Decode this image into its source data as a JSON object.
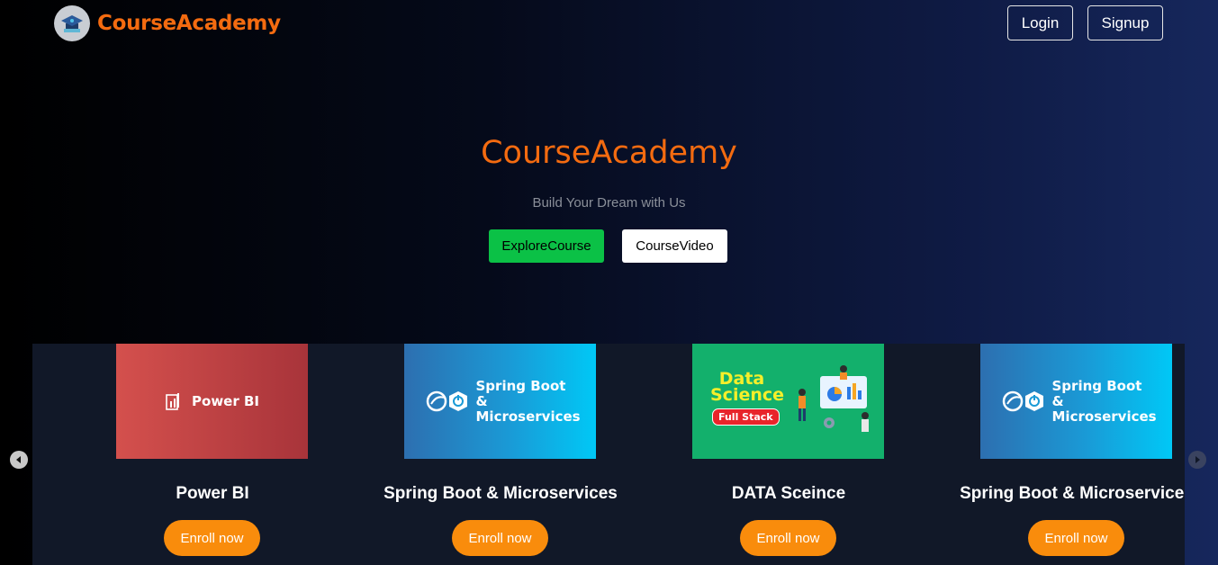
{
  "header": {
    "brand": "CourseAcademy",
    "login_label": "Login",
    "signup_label": "Signup"
  },
  "hero": {
    "title": "CourseAcademy",
    "subtitle": "Build Your Dream with Us",
    "explore_label": "ExploreCourse",
    "video_label": "CourseVideo"
  },
  "courses": [
    {
      "title": "Power BI",
      "thumb_text": "Power BI",
      "enroll_label": "Enroll now"
    },
    {
      "title": "Spring Boot & Microservices",
      "thumb_text": "Spring Boot & Microservices",
      "enroll_label": "Enroll now"
    },
    {
      "title": "DATA Sceince",
      "thumb_title": "Data Science",
      "thumb_badge": "Full Stack",
      "enroll_label": "Enroll now"
    },
    {
      "title": "Spring Boot & Microservices",
      "thumb_text": "Spring Boot & Microservices",
      "enroll_label": "Enroll now"
    }
  ],
  "icons": {
    "logo": "graduation-cap-icon",
    "prev": "chevron-left-icon",
    "next": "chevron-right-icon"
  },
  "colors": {
    "brand": "#f46b10",
    "explore": "#0bc146",
    "enroll": "#f98c0c"
  }
}
